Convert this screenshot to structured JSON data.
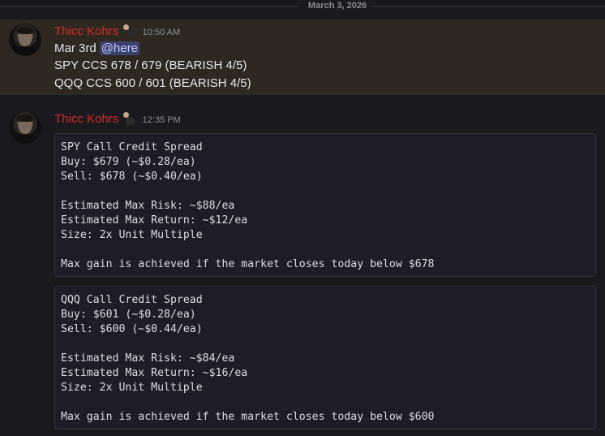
{
  "date_divider": "March 3, 2026",
  "messages": [
    {
      "author": "Thicc Kohrs",
      "time": "10:50 AM",
      "line1_text": "Mar 3rd",
      "mention": "@here",
      "lines": [
        "SPY CCS 678 / 679 (BEARISH 4/5)",
        "QQQ CCS 600 / 601 (BEARISH 4/5)"
      ]
    },
    {
      "author": "Thicc Kohrs",
      "time": "12:35 PM",
      "code_blocks": [
        {
          "lines": [
            "SPY Call Credit Spread",
            "Buy: $679 (~$0.28/ea)",
            "Sell: $678 (~$0.40/ea)",
            "",
            "Estimated Max Risk: ~$88/ea",
            "Estimated Max Return: ~$12/ea",
            "Size: 2x Unit Multiple",
            "",
            "Max gain is achieved if the market closes today below $678"
          ]
        },
        {
          "lines": [
            "QQQ Call Credit Spread",
            "Buy: $601 (~$0.28/ea)",
            "Sell: $600 (~$0.44/ea)",
            "",
            "Estimated Max Risk: ~$84/ea",
            "Estimated Max Return: ~$16/ea",
            "Size: 2x Unit Multiple",
            "",
            "Max gain is achieved if the market closes today below $600"
          ]
        }
      ]
    }
  ],
  "colors": {
    "background": "#1a1a1e",
    "highlight": "#2e2820",
    "username": "#d9282a",
    "mention_bg": "#3c4270",
    "codeblock_bg": "#1c1d29"
  }
}
